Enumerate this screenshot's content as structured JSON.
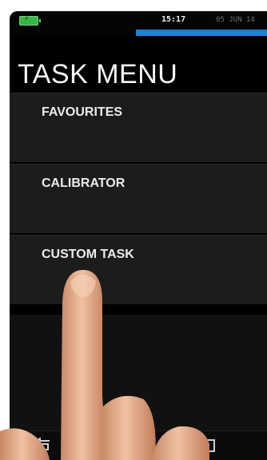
{
  "status_bar": {
    "time": "15:17",
    "date": "05 JUN 14",
    "battery_icon": "battery-icon",
    "progress_fraction": 1.0,
    "accent_color": "#1a82d6",
    "battery_color": "#39b54a"
  },
  "screen": {
    "title": "TASK MENU"
  },
  "menu": {
    "items": [
      {
        "label": "FAVOURITES"
      },
      {
        "label": "CALIBRATOR"
      },
      {
        "label": "CUSTOM TASK"
      }
    ]
  },
  "nav": {
    "back_icon": "back-arrow-icon",
    "home_icon": "home-icon"
  }
}
